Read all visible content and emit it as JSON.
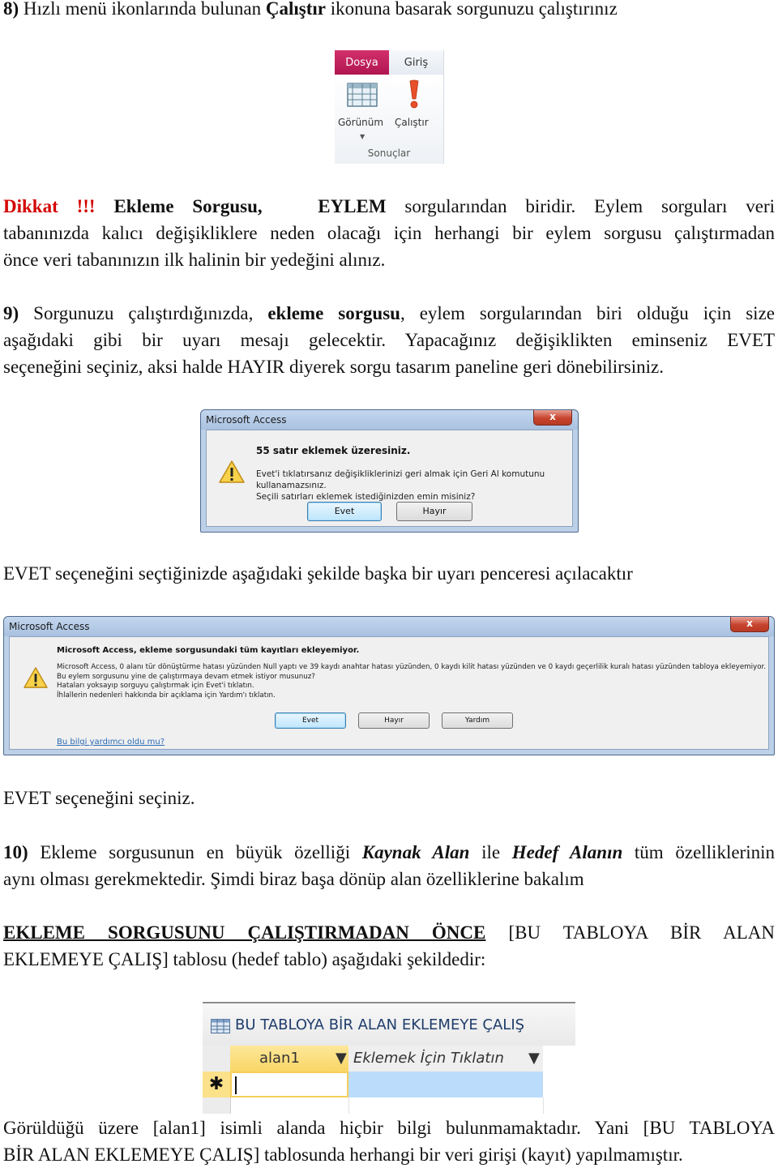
{
  "step8": {
    "num": "8)",
    "before": " Hızlı menü ikonlarında bulunan ",
    "bold": "Çalıştır",
    "after": " ikonuna basarak sorgunuzu çalıştırınız"
  },
  "ribbon": {
    "tab_file": "Dosya",
    "tab_home": "Giriş",
    "view_label": "Görünüm",
    "run_label": "Çalıştır",
    "group_label": "Sonuçlar",
    "icons": {
      "view": "datasheet-grid-icon",
      "run": "exclamation-run-icon"
    }
  },
  "warning_note": {
    "prefix": "Dikkat !!!",
    "bold1": "Ekleme Sorgusu,",
    "bold2": "EYLEM",
    "line1_rest": " sorgularından biridir. Eylem sorguları veri",
    "line2": "tabanınızda kalıcı değişikliklere neden olacağı için herhangi bir eylem sorgusu çalıştırmadan",
    "line3": "önce veri tabanınızın ilk halinin bir yedeğini alınız.",
    "accent_color": "#d40000"
  },
  "step9": {
    "num": "9)",
    "l1_a": " Sorgunuzu çalıştırdığınızda, ",
    "l1_bold": "ekleme sorgusu",
    "l1_b": ", eylem sorgularından biri olduğu için size",
    "line2": "aşağıdaki gibi bir uyarı mesajı gelecektir. Yapacağınız değişiklikten eminseniz EVET",
    "line3": "seçeneğini seçiniz, aksi halde HAYIR diyerek sorgu tasarım paneline geri dönebilirsiniz."
  },
  "dialog1": {
    "title": "Microsoft Access",
    "close": "x",
    "heading": "55 satır eklemek üzeresiniz.",
    "message": [
      "Evet'i tıklatırsanız değişikliklerinizi geri almak için Geri Al komutunu kullanamazsınız.",
      "Seçili satırları eklemek istediğinizden emin misiniz?"
    ],
    "buttons": {
      "yes": "Evet",
      "no": "Hayır"
    },
    "icon": "warning-triangle-icon"
  },
  "after_dialog1": "EVET seçeneğini seçtiğinizde aşağıdaki şekilde başka bir uyarı penceresi açılacaktır",
  "dialog2": {
    "title": "Microsoft Access",
    "close": "x",
    "heading": "Microsoft Access, ekleme sorgusundaki tüm kayıtları ekleyemiyor.",
    "message": [
      "Microsoft Access, 0 alanı tür dönüştürme hatası yüzünden Null yaptı ve 39 kaydı anahtar hatası yüzünden, 0 kaydı kilit hatası yüzünden ve 0 kaydı geçerlilik kuralı hatası yüzünden tabloya ekleyemiyor.",
      "Bu eylem sorgusunu yine de çalıştırmaya devam etmek istiyor musunuz?",
      "Hataları yoksayıp sorguyu çalıştırmak için Evet'i tıklatın.",
      "İhlallerin nedenleri hakkında bir açıklama için Yardım'ı tıklatın."
    ],
    "buttons": {
      "yes": "Evet",
      "no": "Hayır",
      "help": "Yardım"
    },
    "help_link": "Bu bilgi yardımcı oldu mu?",
    "icon": "warning-triangle-icon"
  },
  "select_yes": "EVET seçeneğini seçiniz.",
  "step10": {
    "num": "10)",
    "a": " Ekleme sorgusunun en büyük özelliği ",
    "bi1": "Kaynak Alan",
    "b": " ile ",
    "bi2": "Hedef Alanın",
    "c": " tüm özelliklerinin",
    "line2": "aynı olması gerekmektedir.  Şimdi biraz başa dönüp alan özelliklerine bakalım"
  },
  "before_run": {
    "underlined": "EKLEME SORGUSUNU ÇALIŞTIRMADAN ÖNCE",
    "rest1": " [BU TABLOYA BİR ALAN",
    "line2": "EKLEMEYE ÇALIŞ] tablosu (hedef tablo) aşağıdaki şekildedir:"
  },
  "datasheet": {
    "title": "BU TABLOYA BİR ALAN EKLEMEYE ÇALIŞ",
    "columns": [
      "alan1",
      "Eklemek İçin Tıklatın"
    ],
    "new_row_marker": "✱",
    "icon": "table-icon"
  },
  "conclusion": {
    "line1": "Görüldüğü üzere [alan1] isimli alanda hiçbir bilgi bulunmamaktadır.  Yani [BU TABLOYA",
    "line2": "BİR ALAN EKLEMEYE ÇALIŞ] tablosunda herhangi bir veri girişi (kayıt) yapılmamıştır."
  }
}
